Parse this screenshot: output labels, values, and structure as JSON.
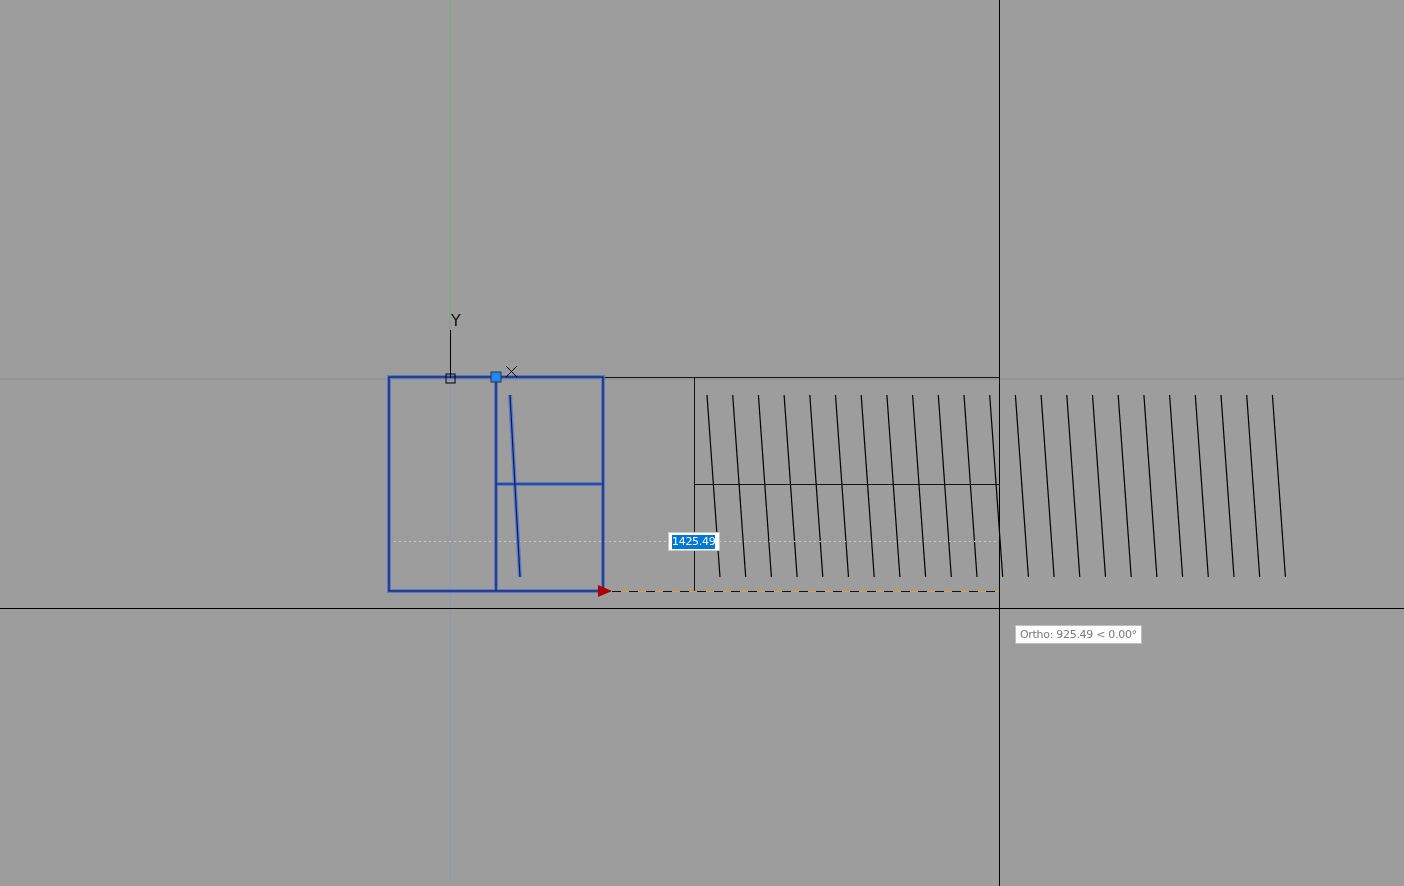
{
  "viewport": {
    "ucs_label": "Y",
    "dynamic_input": {
      "value": "1425.49",
      "selected": true
    },
    "tooltip": "Ortho: 925.49 < 0.00°"
  }
}
